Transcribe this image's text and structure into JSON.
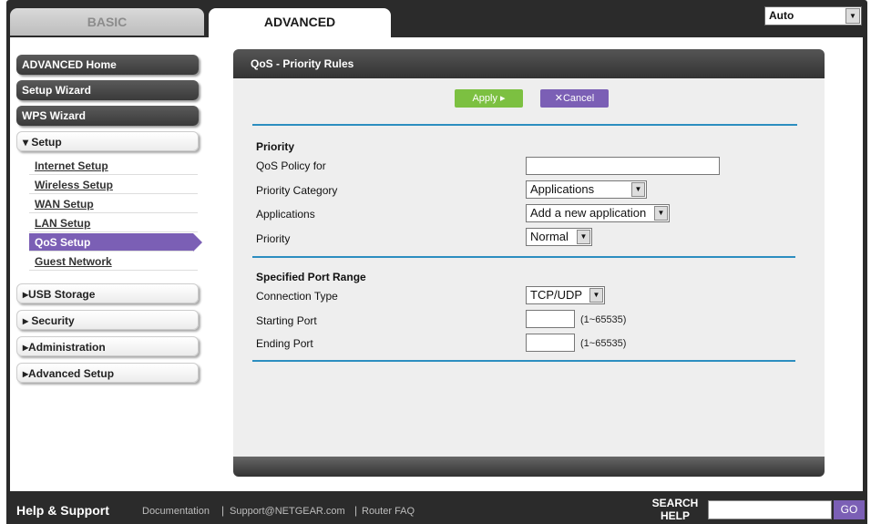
{
  "tabs": {
    "basic": "BASIC",
    "advanced": "ADVANCED"
  },
  "language_select": {
    "value": "Auto"
  },
  "sidebar": {
    "advanced_home": "ADVANCED Home",
    "setup_wizard": "Setup Wizard",
    "wps_wizard": "WPS Wizard",
    "setup": "▾ Setup",
    "setup_items": [
      "Internet Setup",
      "Wireless Setup",
      "WAN Setup",
      "LAN Setup",
      "QoS Setup",
      "Guest Network"
    ],
    "usb_storage": "▸USB Storage",
    "security": "▸ Security",
    "administration": "▸Administration",
    "advanced_setup": "▸Advanced Setup"
  },
  "panel": {
    "title": "QoS - Priority Rules",
    "apply": "Apply ▸",
    "cancel": "✕Cancel",
    "priority_heading": "Priority",
    "qos_policy_label": "QoS Policy for",
    "qos_policy_value": "",
    "priority_category_label": "Priority Category",
    "priority_category_value": "Applications",
    "applications_label": "Applications",
    "applications_value": "Add a new application",
    "priority_label": "Priority",
    "priority_value": "Normal",
    "port_range_heading": "Specified Port Range",
    "connection_type_label": "Connection Type",
    "connection_type_value": "TCP/UDP",
    "starting_port_label": "Starting Port",
    "starting_port_hint": "(1~65535)",
    "ending_port_label": "Ending Port",
    "ending_port_hint": "(1~65535)"
  },
  "footer": {
    "help_title": "Help & Support",
    "documentation": "Documentation",
    "support_email": "Support@NETGEAR.com",
    "router_faq": "Router FAQ",
    "separator": "|",
    "search_label": "SEARCH HELP",
    "go": "GO"
  }
}
